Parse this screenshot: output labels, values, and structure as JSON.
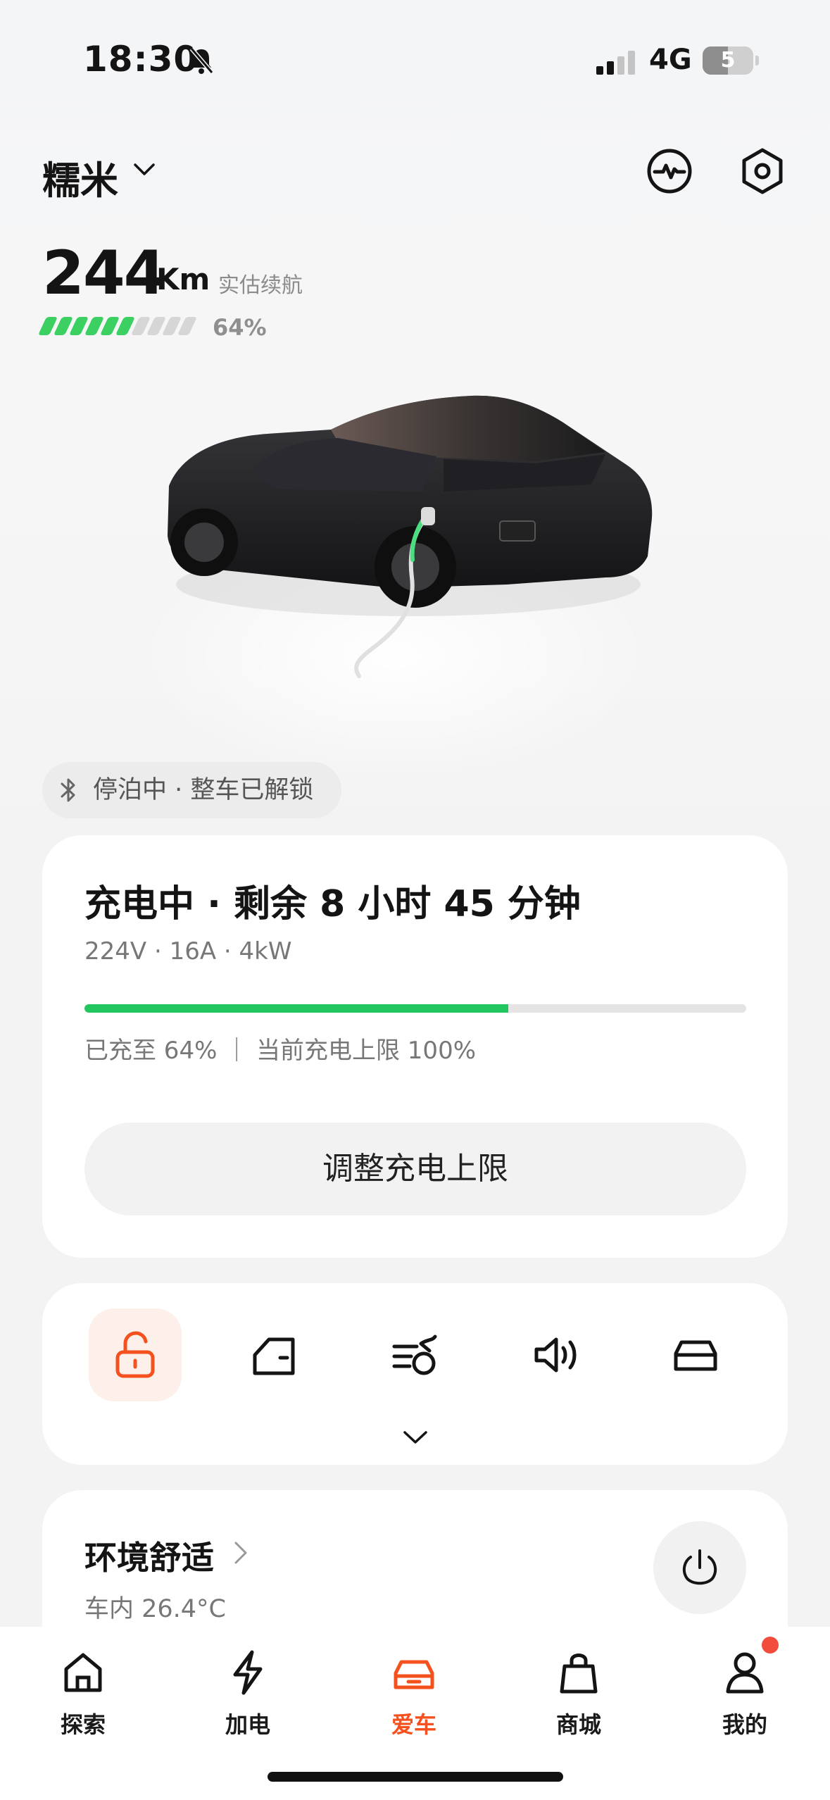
{
  "status_bar": {
    "time": "18:30",
    "network": "4G",
    "battery": "5"
  },
  "header": {
    "car_name": "糯米",
    "range_value": "244",
    "range_unit": "Km",
    "range_label": "实估续航",
    "battery_percent": "64%",
    "battery_level": 0.64
  },
  "parking": {
    "status": "停泊中 · 整车已解锁"
  },
  "charging": {
    "title": "充电中 · 剩余 8 小时 45 分钟",
    "spec": "224V · 16A · 4kW",
    "progress": 0.64,
    "status": "已充至 64% ｜ 当前充电上限 100%",
    "button_label": "调整充电上限"
  },
  "controls": {
    "items": [
      "unlock-icon",
      "door-icon",
      "climate-fan-icon",
      "horn-icon",
      "car-icon"
    ]
  },
  "comfort": {
    "title": "环境舒适",
    "temperature": "车内 26.4°C"
  },
  "tabbar": {
    "items": [
      {
        "label": "探索",
        "icon": "home-icon"
      },
      {
        "label": "加电",
        "icon": "lightning-icon"
      },
      {
        "label": "爱车",
        "icon": "car-icon"
      },
      {
        "label": "商城",
        "icon": "bag-icon"
      },
      {
        "label": "我的",
        "icon": "person-icon"
      }
    ],
    "active": "爱车"
  },
  "colors": {
    "accent": "#f4511e",
    "progress": "#22c55e",
    "range_bar": "#3ccf62",
    "badge": "#f24c3d"
  }
}
